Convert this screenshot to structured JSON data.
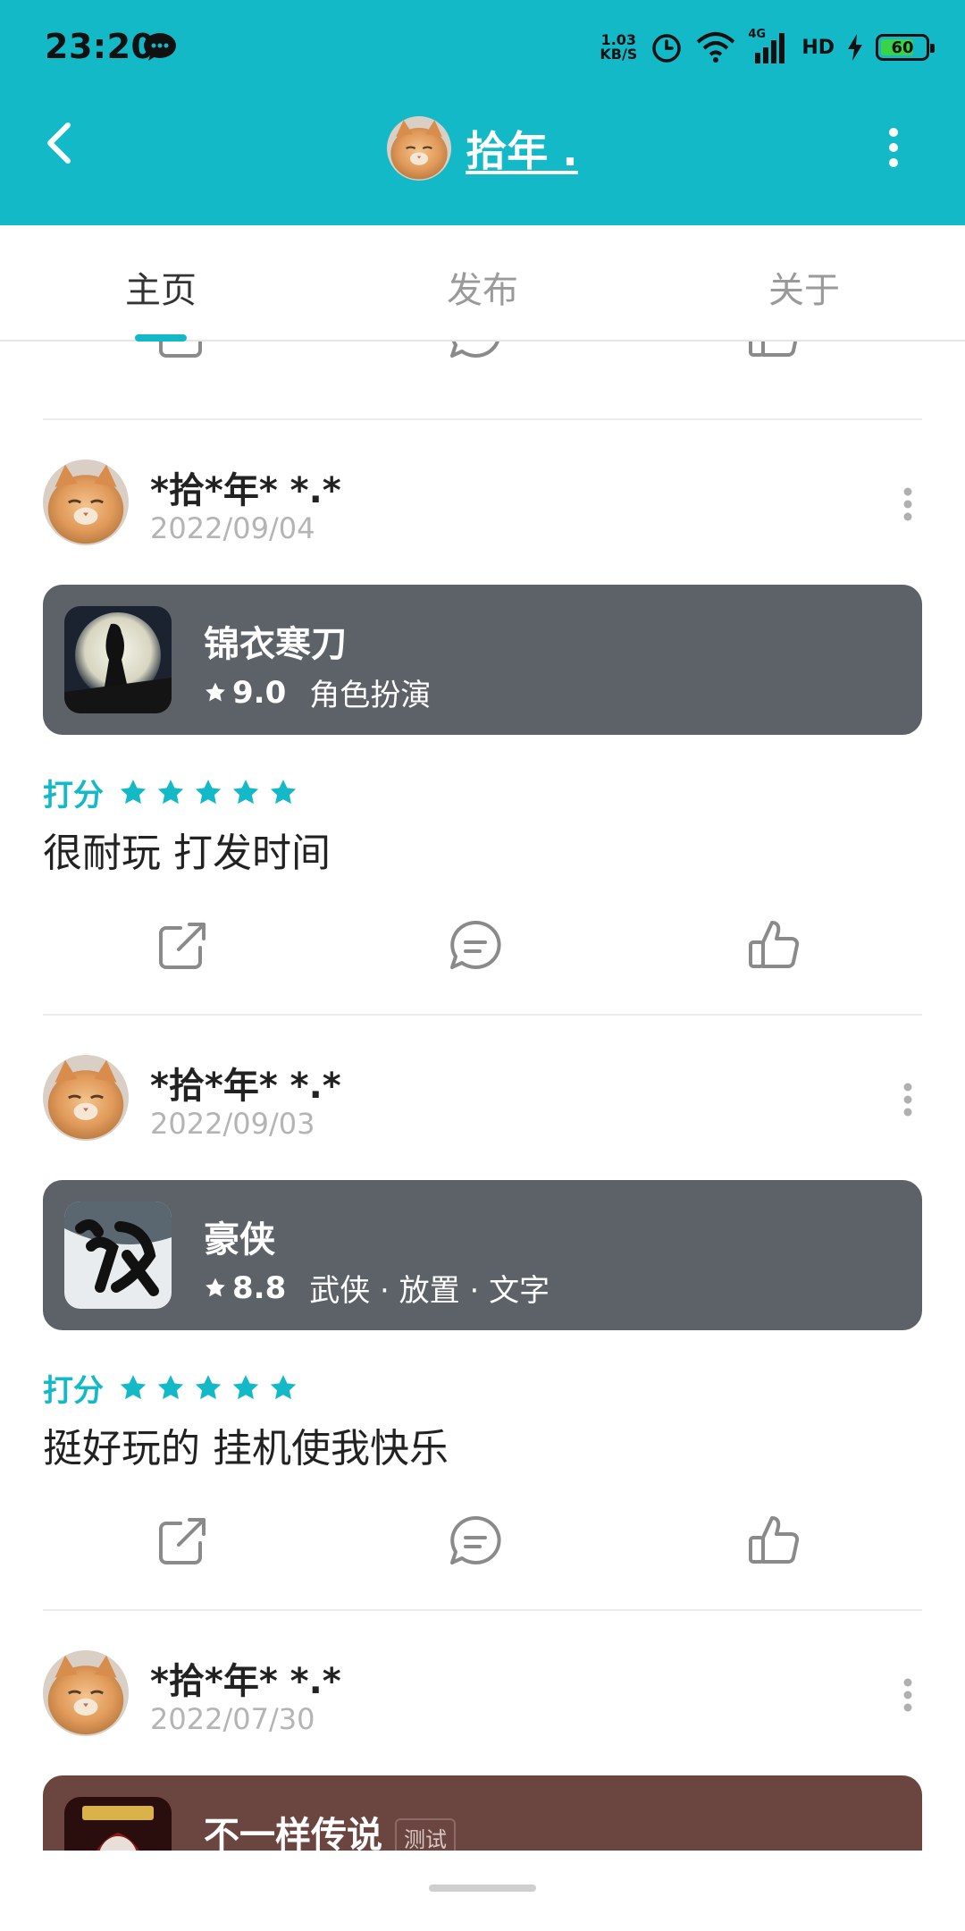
{
  "status_bar": {
    "time": "23:20",
    "net_speed": "1.03",
    "net_unit": "KB/S",
    "signal": "4G",
    "hd": "HD",
    "battery": "60"
  },
  "header": {
    "title": "拾年 ."
  },
  "tabs": [
    {
      "label": "主页"
    },
    {
      "label": "发布"
    },
    {
      "label": "关于"
    }
  ],
  "posts": [
    {
      "author": "*拾*年* *.*",
      "date": "2022/09/04",
      "game": {
        "title": "锦衣寒刀",
        "score": "9.0",
        "tags": "角色扮演"
      },
      "rating_label": "打分",
      "stars": 5,
      "review": "很耐玩 打发时间"
    },
    {
      "author": "*拾*年* *.*",
      "date": "2022/09/03",
      "game": {
        "title": "豪侠",
        "score": "8.8",
        "tags": "武侠 · 放置 · 文字"
      },
      "rating_label": "打分",
      "stars": 5,
      "review": "挺好玩的 挂机使我快乐"
    },
    {
      "author": "*拾*年* *.*",
      "date": "2022/07/30",
      "game": {
        "title": "不一样传说",
        "badge": "测试"
      }
    }
  ],
  "colors": {
    "accent": "#14b9c8",
    "card_gray": "#5d6268",
    "card_brown": "#6b4540"
  }
}
